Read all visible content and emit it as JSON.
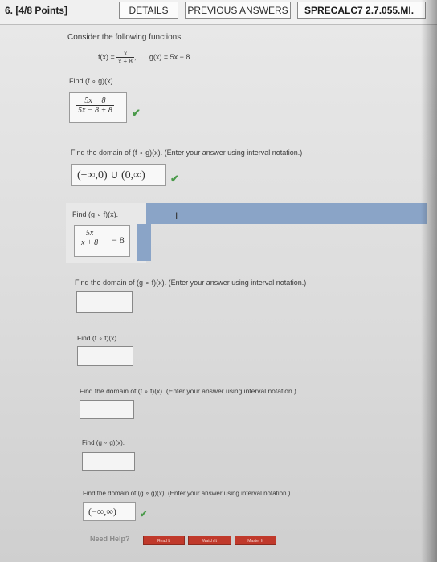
{
  "header": {
    "question_label": "6. [4/8 Points]",
    "details_label": "DETAILS",
    "previous_answers_label": "PREVIOUS ANSWERS",
    "problem_code": "SPRECALC7 2.7.055.MI."
  },
  "intro": "Consider the following functions.",
  "functions": {
    "f_lhs": "f(x) =",
    "f_num": "x",
    "f_den": "x + 8",
    "f_comma": ",",
    "g_def": "g(x) = 5x − 8"
  },
  "parts": [
    {
      "prompt": "Find  (f ∘ g)(x).",
      "answer_num": "5x − 8",
      "answer_den": "5x − 8 + 8",
      "status": "correct"
    },
    {
      "prompt": "Find the domain of  (f ∘ g)(x).  (Enter your answer using interval notation.)",
      "answer": "(−∞,0) ∪ (0,∞)",
      "status": "correct"
    },
    {
      "prompt": "Find  (g ∘ f)(x).",
      "answer_num": "5x",
      "answer_den": "x + 8",
      "answer_tail": "− 8",
      "status": "in-progress"
    },
    {
      "prompt": "Find the domain of  (g ∘ f)(x).  (Enter your answer using interval notation.)",
      "answer": ""
    },
    {
      "prompt": "Find  (f ∘ f)(x).",
      "answer": ""
    },
    {
      "prompt": "Find the domain of  (f ∘ f)(x).  (Enter your answer using interval notation.)",
      "answer": ""
    },
    {
      "prompt": "Find  (g ∘ g)(x).",
      "answer": ""
    },
    {
      "prompt": "Find the domain of  (g ∘ g)(x).  (Enter your answer using interval notation.)",
      "answer": "(−∞,∞)",
      "status": "correct"
    }
  ],
  "help": {
    "label": "Need Help?",
    "read_it": "Read It",
    "watch_it": "Watch It",
    "master_it": "Master It"
  },
  "icons": {
    "correct": "check-icon",
    "cursor": "text-cursor-icon"
  },
  "colors": {
    "correct_green": "#4a9a4a",
    "highlight_blue": "#8aa4c7",
    "help_red": "#c0392b"
  }
}
